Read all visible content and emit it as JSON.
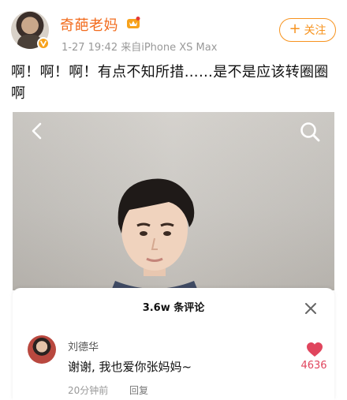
{
  "header": {
    "username": "奇葩老妈",
    "meta": "1-27 19:42  来自iPhone XS Max",
    "follow_label": "关注",
    "follow_plus": "+"
  },
  "post": {
    "text": "啊！啊！啊！有点不知所措……是不是应该转圈圈啊"
  },
  "comments": {
    "title": "3.6w 条评论",
    "items": [
      {
        "author": "刘德华",
        "text": "谢谢, 我也爱你张妈妈~",
        "time": "20分钟前",
        "reply_label": "回复",
        "likes": "4636"
      }
    ]
  },
  "colors": {
    "brand_orange": "#f26b1d",
    "follow_orange": "#f7931e",
    "like_red": "#e0455d"
  },
  "icons": [
    "vip-crown-icon",
    "verified-badge-icon",
    "back-chevron-icon",
    "search-icon",
    "close-icon",
    "heart-icon"
  ]
}
